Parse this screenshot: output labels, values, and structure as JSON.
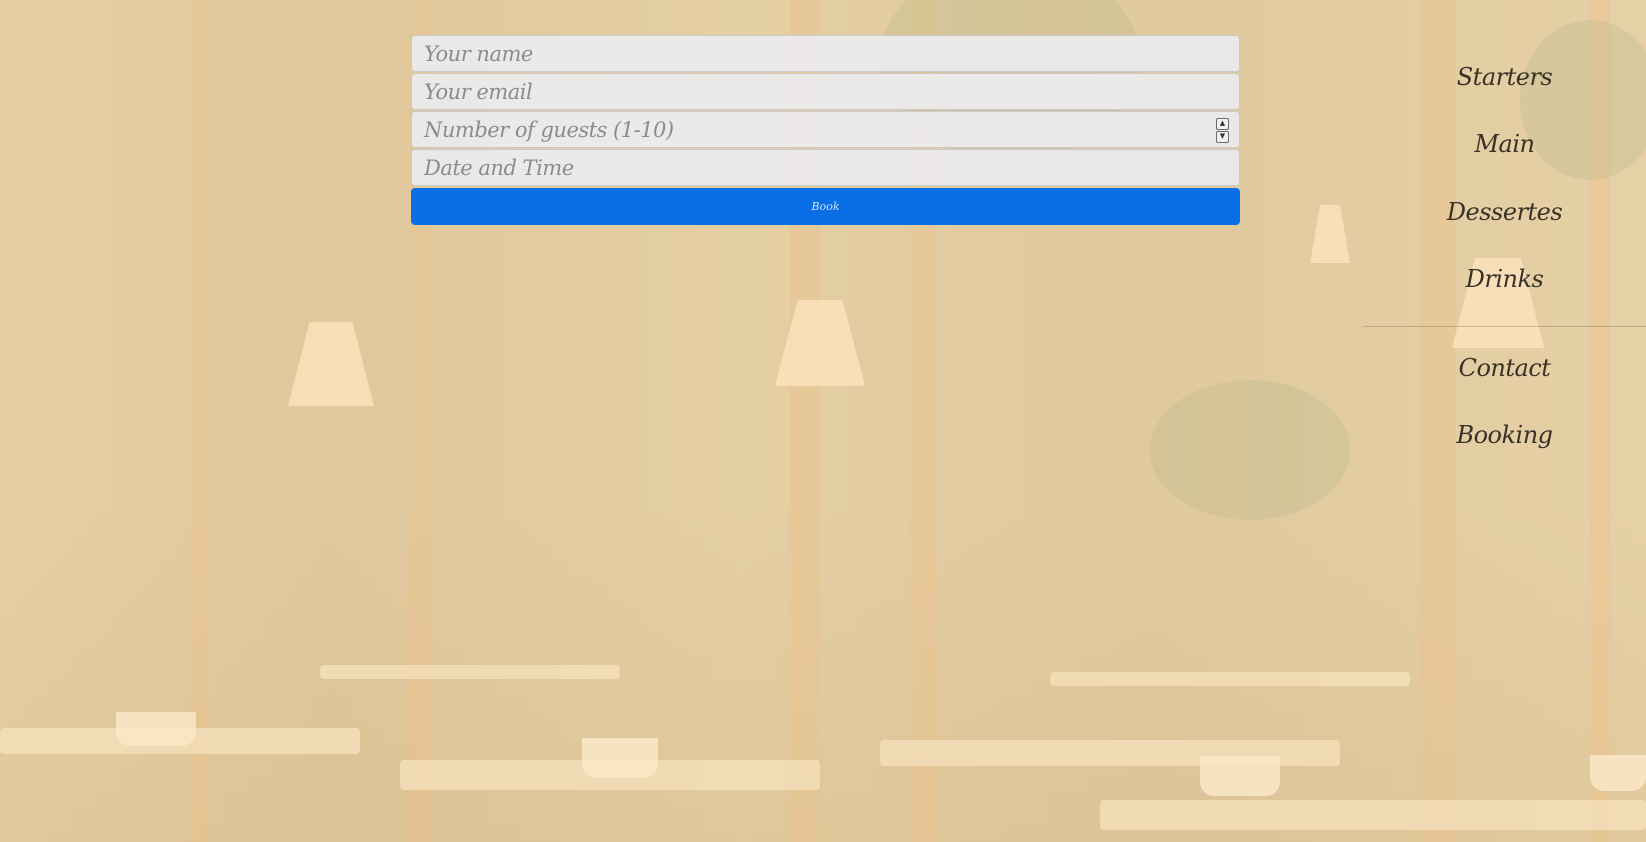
{
  "form": {
    "name_placeholder": "Your name",
    "email_placeholder": "Your email",
    "guests_placeholder": "Number of guests (1-10)",
    "datetime_placeholder": "Date and Time",
    "submit_label": "Book",
    "accent_color": "#0a6fe6"
  },
  "nav": {
    "menu_items": [
      "Starters",
      "Main",
      "Dessertes",
      "Drinks"
    ],
    "page_items": [
      "Contact",
      "Booking"
    ]
  }
}
